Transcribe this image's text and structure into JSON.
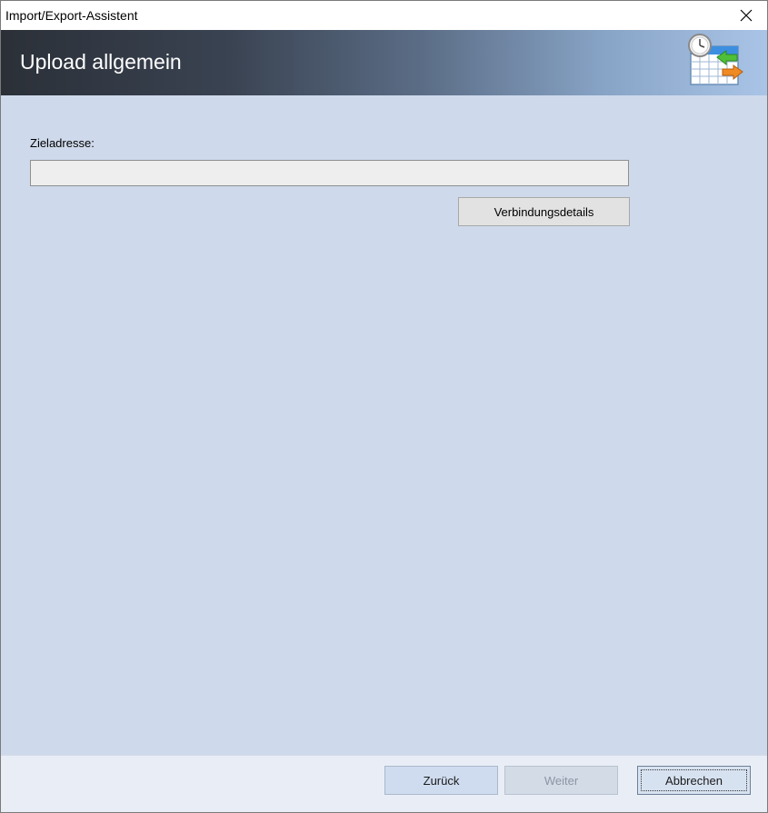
{
  "window": {
    "title": "Import/Export-Assistent"
  },
  "banner": {
    "heading": "Upload allgemein"
  },
  "form": {
    "target_label": "Zieladresse:",
    "target_value": "",
    "details_button": "Verbindungsdetails"
  },
  "footer": {
    "back_label": "Zurück",
    "next_label": "Weiter",
    "cancel_label": "Abbrechen"
  },
  "icons": {
    "close": "close-icon",
    "logo": "calendar-clock-transfer-icon"
  }
}
